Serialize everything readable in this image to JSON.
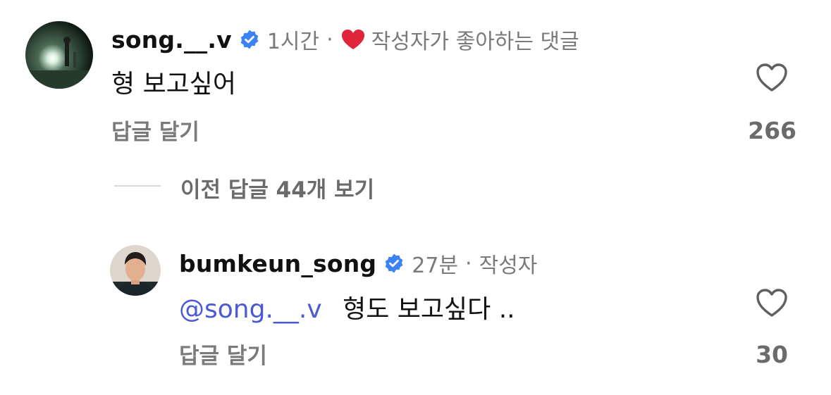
{
  "comments": [
    {
      "username": "song.__.v",
      "time": "1시간",
      "separator": "·",
      "liked_by_author_label": "작성자가 좋아하는 댓글",
      "text": "형 보고싶어",
      "reply_label": "답글 달기",
      "likes": "266"
    }
  ],
  "thread": {
    "view_replies_label": "이전 답글 44개 보기"
  },
  "reply": {
    "username": "bumkeun_song",
    "time": "27분",
    "separator": "·",
    "author_label": "작성자",
    "mention": "@song.__.v",
    "text": "형도 보고싶다 ..",
    "reply_label": "답글 달기",
    "likes": "30"
  },
  "icons": {
    "verified": "verified-badge-icon",
    "like": "heart-outline-icon",
    "author_like": "heart-filled-icon"
  },
  "colors": {
    "verified": "#3b82f6",
    "heart_red": "#e0243a",
    "mention": "#4a5ad6",
    "muted": "#7a7a7a"
  }
}
